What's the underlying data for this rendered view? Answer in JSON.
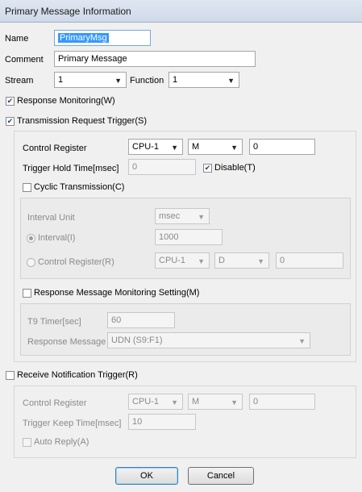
{
  "window": {
    "title": "Primary Message Information"
  },
  "name": {
    "label": "Name",
    "value": "PrimaryMsg"
  },
  "comment": {
    "label": "Comment",
    "value": "Primary Message"
  },
  "stream": {
    "label": "Stream",
    "value": "1"
  },
  "function": {
    "label": "Function",
    "value": "1"
  },
  "response_monitoring": {
    "label": "Response Monitoring(W)",
    "checked": true
  },
  "transmission_trigger": {
    "label": "Transmission Request Trigger(S)",
    "checked": true,
    "control_register": {
      "label": "Control Register",
      "cpu": "CPU-1",
      "device": "M",
      "address": "0"
    },
    "trigger_hold_time": {
      "label": "Trigger Hold Time[msec]",
      "value": "0"
    },
    "disable": {
      "label": "Disable(T)",
      "checked": true
    },
    "cyclic": {
      "label": "Cyclic Transmission(C)",
      "checked": false,
      "interval_unit": {
        "label": "Interval Unit",
        "value": "msec"
      },
      "interval": {
        "label": "Interval(I)",
        "value": "1000"
      },
      "control_register": {
        "label": "Control Register(R)",
        "cpu": "CPU-1",
        "device": "D",
        "address": "0"
      }
    },
    "response_monitoring_setting": {
      "label": "Response Message Monitoring Setting(M)",
      "checked": false,
      "t9_timer": {
        "label": "T9 Timer[sec]",
        "value": "60"
      },
      "response_message": {
        "label": "Response Message",
        "value": "UDN (S9:F1)"
      }
    }
  },
  "receive_trigger": {
    "label": "Receive Notification Trigger(R)",
    "checked": false,
    "control_register": {
      "label": "Control Register",
      "cpu": "CPU-1",
      "device": "M",
      "address": "0"
    },
    "trigger_keep_time": {
      "label": "Trigger Keep Time[msec]",
      "value": "10"
    },
    "auto_reply": {
      "label": "Auto Reply(A)",
      "checked": false
    }
  },
  "buttons": {
    "ok": "OK",
    "cancel": "Cancel"
  }
}
